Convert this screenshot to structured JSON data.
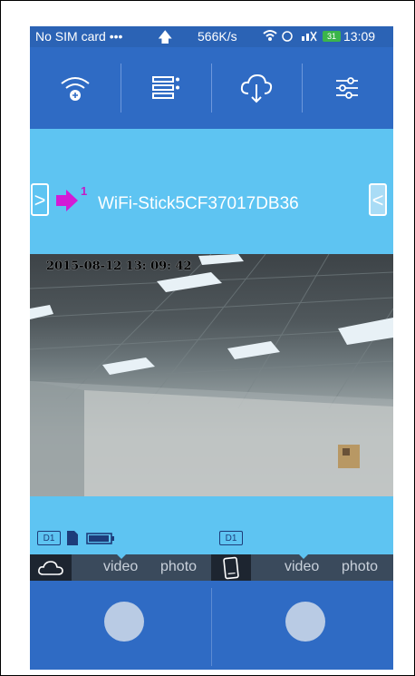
{
  "status_bar": {
    "carrier": "No SIM card",
    "dots": "•••",
    "upload_arrow": "🡅",
    "speed": "566K/s",
    "battery": "31",
    "time": "13:09"
  },
  "toolbar": {
    "items": [
      {
        "name": "wifi-add-icon"
      },
      {
        "name": "list-icon"
      },
      {
        "name": "cloud-download-icon"
      },
      {
        "name": "settings-sliders-icon"
      }
    ]
  },
  "device": {
    "left_nav": ">",
    "pointer_number": "1",
    "name": "WiFi-Stick5CF37017DB36",
    "right_nav": "<"
  },
  "video": {
    "timestamp": "2015-08-12 13: 09: 42"
  },
  "info": {
    "left_badge": "D1",
    "right_badge": "D1"
  },
  "tabs": {
    "left": {
      "video": "video",
      "photo": "photo"
    },
    "right": {
      "video": "video",
      "photo": "photo"
    }
  },
  "colors": {
    "toolbar": "#2f6bc4",
    "light_blue": "#5ec4f2",
    "tab_bar": "#3a4a5c",
    "pointer": "#d21bd6"
  }
}
